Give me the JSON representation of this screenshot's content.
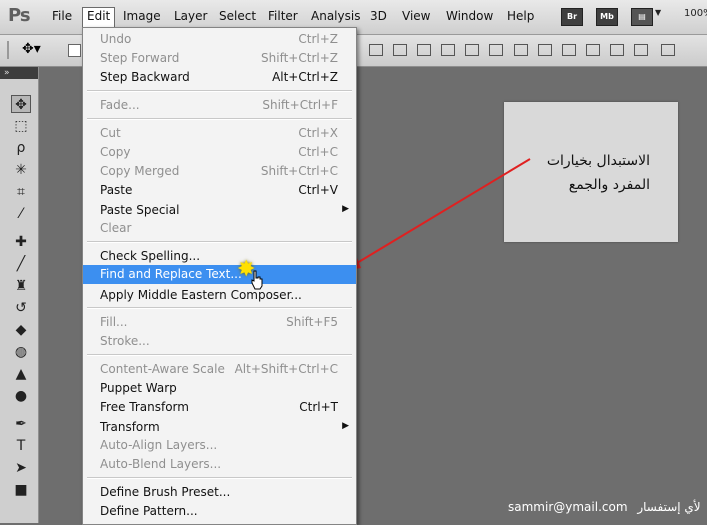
{
  "app": {
    "logo": "Ps"
  },
  "menubar": {
    "items": [
      "File",
      "Edit",
      "Image",
      "Layer",
      "Select",
      "Filter",
      "Analysis",
      "3D",
      "View",
      "Window",
      "Help"
    ],
    "active": "Edit",
    "badges": [
      "Br",
      "Mb"
    ],
    "zoom": "100%"
  },
  "edit_menu": {
    "items": [
      {
        "label": "Undo",
        "shortcut": "Ctrl+Z",
        "disabled": true
      },
      {
        "label": "Step Forward",
        "shortcut": "Shift+Ctrl+Z",
        "disabled": true
      },
      {
        "label": "Step Backward",
        "shortcut": "Alt+Ctrl+Z",
        "disabled": false
      },
      {
        "label": "Fade...",
        "shortcut": "Shift+Ctrl+F",
        "disabled": true
      },
      {
        "label": "Cut",
        "shortcut": "Ctrl+X",
        "disabled": true
      },
      {
        "label": "Copy",
        "shortcut": "Ctrl+C",
        "disabled": true
      },
      {
        "label": "Copy Merged",
        "shortcut": "Shift+Ctrl+C",
        "disabled": true
      },
      {
        "label": "Paste",
        "shortcut": "Ctrl+V",
        "disabled": false
      },
      {
        "label": "Paste Special",
        "shortcut": "",
        "disabled": false,
        "submenu": true
      },
      {
        "label": "Clear",
        "shortcut": "",
        "disabled": true
      },
      {
        "label": "Check Spelling...",
        "shortcut": "",
        "disabled": false
      },
      {
        "label": "Find and Replace Text...",
        "shortcut": "",
        "disabled": false,
        "highlighted": true
      },
      {
        "label": "Apply Middle Eastern Composer...",
        "shortcut": "",
        "disabled": false
      },
      {
        "label": "Fill...",
        "shortcut": "Shift+F5",
        "disabled": true
      },
      {
        "label": "Stroke...",
        "shortcut": "",
        "disabled": true
      },
      {
        "label": "Content-Aware Scale",
        "shortcut": "Alt+Shift+Ctrl+C",
        "disabled": true
      },
      {
        "label": "Puppet Warp",
        "shortcut": "",
        "disabled": false
      },
      {
        "label": "Free Transform",
        "shortcut": "Ctrl+T",
        "disabled": false
      },
      {
        "label": "Transform",
        "shortcut": "",
        "disabled": false,
        "submenu": true
      },
      {
        "label": "Auto-Align Layers...",
        "shortcut": "",
        "disabled": true
      },
      {
        "label": "Auto-Blend Layers...",
        "shortcut": "",
        "disabled": true
      },
      {
        "label": "Define Brush Preset...",
        "shortcut": "",
        "disabled": false
      },
      {
        "label": "Define Pattern...",
        "shortcut": "",
        "disabled": false
      }
    ]
  },
  "callout": {
    "lines": [
      "الاستبدال بخيارات",
      "المفرد والجمع"
    ]
  },
  "footer": {
    "email": "sammir@ymail.com",
    "label": "لأي إستفسار"
  },
  "colors": {
    "highlight": "#3c8ff0",
    "arrow": "#e02020",
    "burst": "#ffe000"
  }
}
